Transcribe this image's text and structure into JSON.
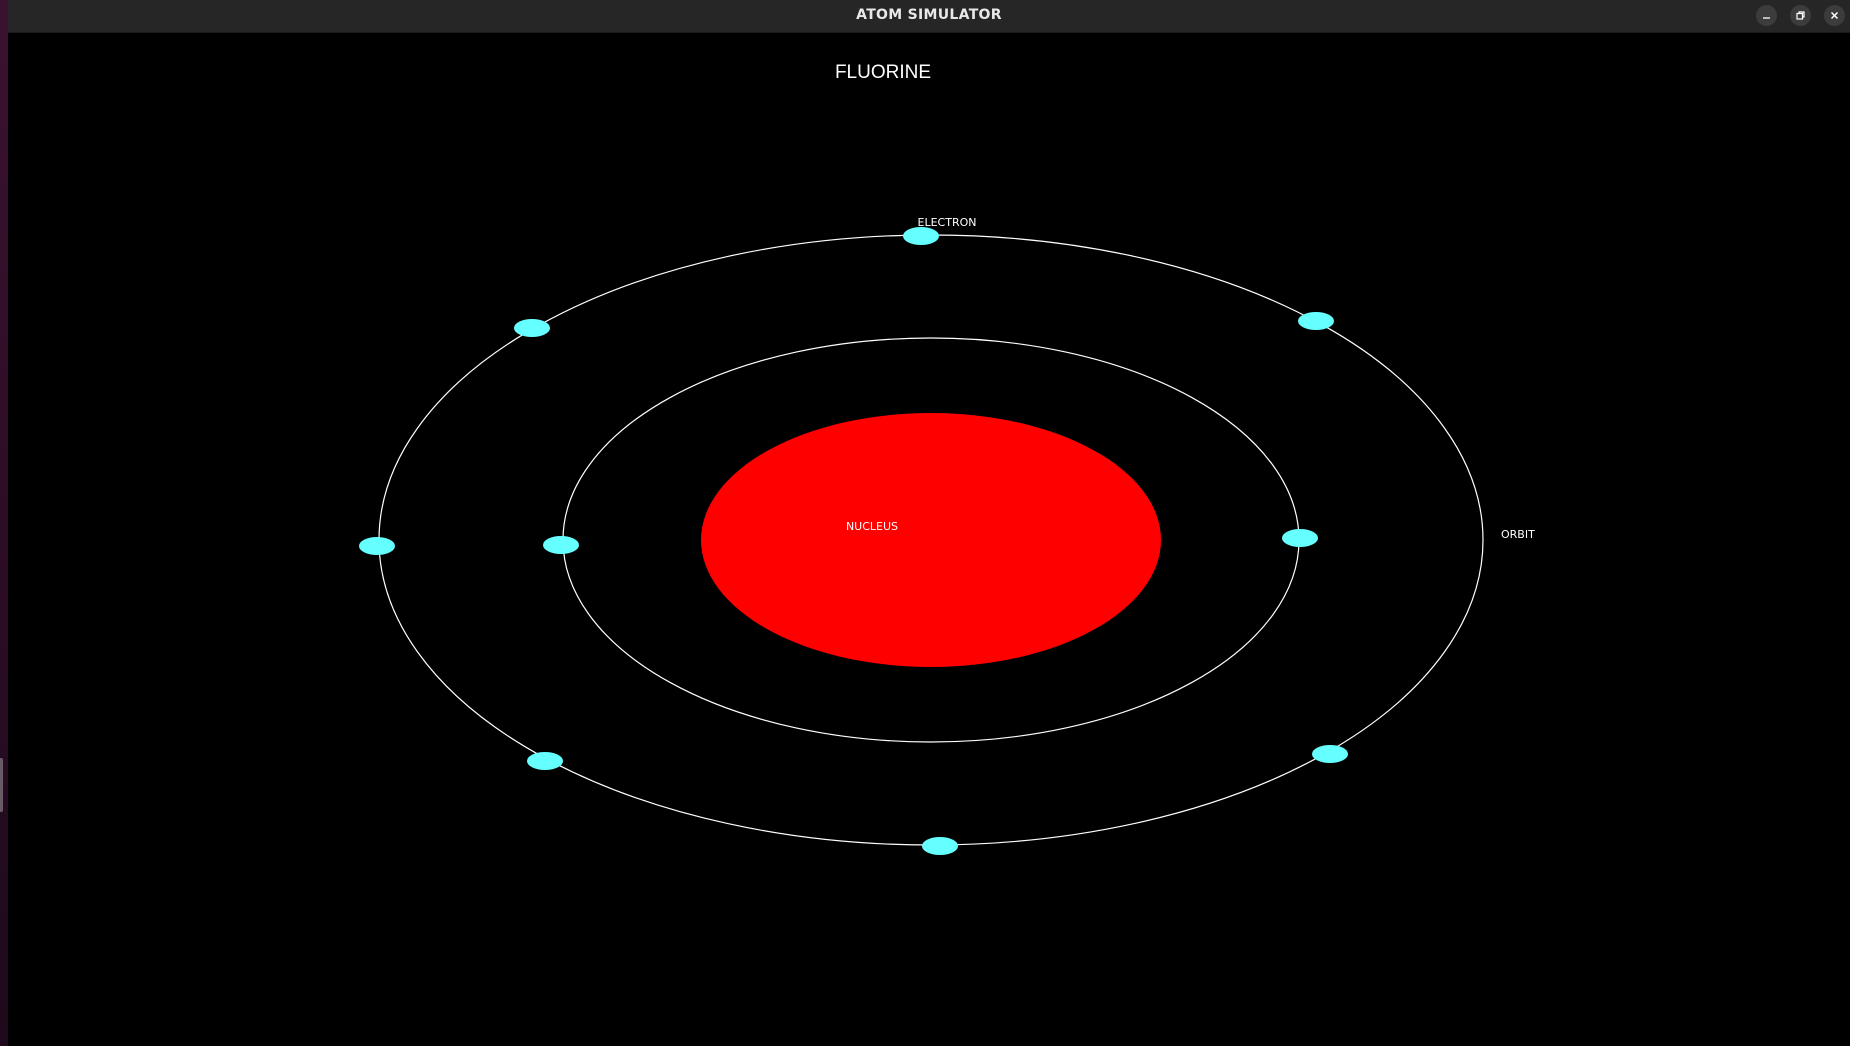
{
  "window": {
    "title": "ATOM SIMULATOR",
    "buttons": {
      "minimize_icon": "minimize-icon",
      "maximize_icon": "restore-icon",
      "close_icon": "close-icon"
    }
  },
  "scene": {
    "element_name": "FLUORINE",
    "labels": {
      "electron": "ELECTRON",
      "nucleus": "NUCLEUS",
      "orbit": "ORBIT"
    },
    "electron_count": 9,
    "shells": [
      {
        "name": "inner",
        "electrons": 2
      },
      {
        "name": "outer",
        "electrons": 7
      }
    ],
    "colors": {
      "background": "#000000",
      "nucleus": "#ff0000",
      "electron": "#66ffff",
      "orbit": "#ffffff",
      "text": "#ffffff"
    }
  }
}
